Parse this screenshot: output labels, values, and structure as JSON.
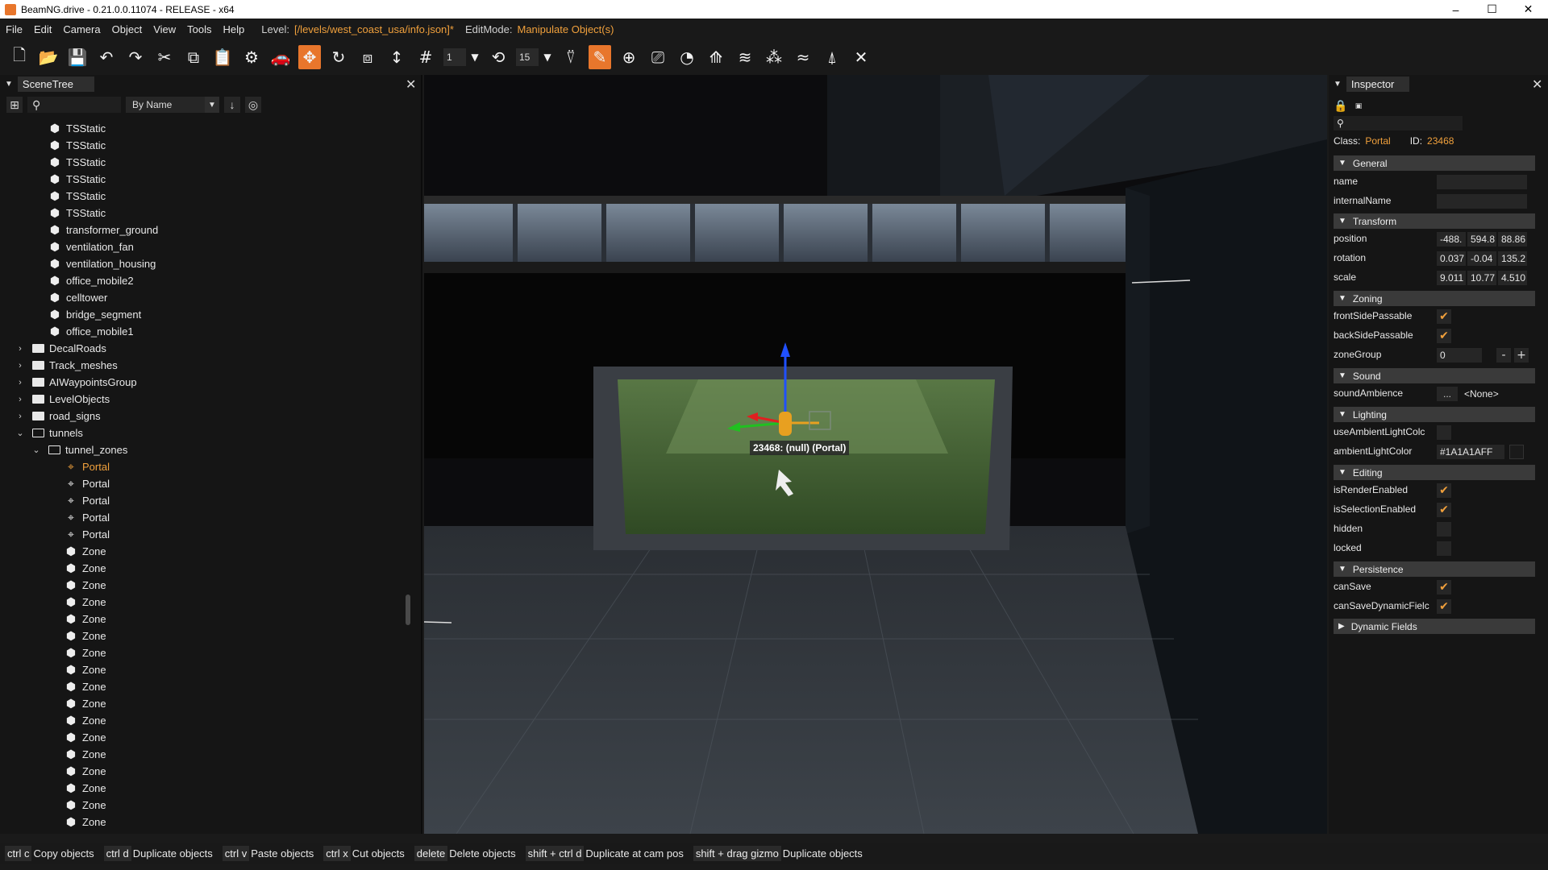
{
  "window": {
    "title": "BeamNG.drive - 0.21.0.0.11074 - RELEASE - x64",
    "minimize": "–",
    "maximize": "☐",
    "close": "✕"
  },
  "menu": {
    "items": [
      "File",
      "Edit",
      "Camera",
      "Object",
      "View",
      "Tools",
      "Help"
    ],
    "level_label": "Level:",
    "level_value": "[/levels/west_coast_usa/info.json]*",
    "editmode_label": "EditMode:",
    "editmode_value": "Manipulate Object(s)"
  },
  "toolbar": {
    "grid_value": "1",
    "rotate_snap_value": "15"
  },
  "scenetree": {
    "title": "SceneTree",
    "sort_option": "By Name",
    "items": [
      {
        "label": "TSStatic",
        "icon": "cube-icon",
        "depth": 2
      },
      {
        "label": "TSStatic",
        "icon": "cube-icon",
        "depth": 2
      },
      {
        "label": "TSStatic",
        "icon": "cube-icon",
        "depth": 2
      },
      {
        "label": "TSStatic",
        "icon": "cube-icon",
        "depth": 2
      },
      {
        "label": "TSStatic",
        "icon": "cube-icon",
        "depth": 2
      },
      {
        "label": "TSStatic",
        "icon": "cube-icon",
        "depth": 2
      },
      {
        "label": "transformer_ground",
        "icon": "cube-icon",
        "depth": 2
      },
      {
        "label": "ventilation_fan",
        "icon": "cube-icon",
        "depth": 2
      },
      {
        "label": "ventilation_housing",
        "icon": "cube-icon",
        "depth": 2
      },
      {
        "label": "office_mobile2",
        "icon": "cube-icon",
        "depth": 2
      },
      {
        "label": "celltower",
        "icon": "cube-icon",
        "depth": 2
      },
      {
        "label": "bridge_segment",
        "icon": "cube-icon",
        "depth": 2
      },
      {
        "label": "office_mobile1",
        "icon": "cube-icon",
        "depth": 2
      },
      {
        "label": "DecalRoads",
        "icon": "folder-icon",
        "depth": 1,
        "arrow": "›"
      },
      {
        "label": "Track_meshes",
        "icon": "folder-icon",
        "depth": 1,
        "arrow": "›"
      },
      {
        "label": "AIWaypointsGroup",
        "icon": "folder-icon",
        "depth": 1,
        "arrow": "›"
      },
      {
        "label": "LevelObjects",
        "icon": "folder-icon",
        "depth": 1,
        "arrow": "›"
      },
      {
        "label": "road_signs",
        "icon": "folder-icon",
        "depth": 1,
        "arrow": "›"
      },
      {
        "label": "tunnels",
        "icon": "folder-open-icon",
        "depth": 1,
        "arrow": "⌄"
      },
      {
        "label": "tunnel_zones",
        "icon": "folder-open-icon",
        "depth": 2,
        "arrow": "⌄"
      },
      {
        "label": "Portal",
        "icon": "portal-icon",
        "depth": 3,
        "selected": true
      },
      {
        "label": "Portal",
        "icon": "portal-icon",
        "depth": 3
      },
      {
        "label": "Portal",
        "icon": "portal-icon",
        "depth": 3
      },
      {
        "label": "Portal",
        "icon": "portal-icon",
        "depth": 3
      },
      {
        "label": "Portal",
        "icon": "portal-icon",
        "depth": 3
      },
      {
        "label": "Zone",
        "icon": "zone-icon",
        "depth": 3
      },
      {
        "label": "Zone",
        "icon": "zone-icon",
        "depth": 3
      },
      {
        "label": "Zone",
        "icon": "zone-icon",
        "depth": 3
      },
      {
        "label": "Zone",
        "icon": "zone-icon",
        "depth": 3
      },
      {
        "label": "Zone",
        "icon": "zone-icon",
        "depth": 3
      },
      {
        "label": "Zone",
        "icon": "zone-icon",
        "depth": 3
      },
      {
        "label": "Zone",
        "icon": "zone-icon",
        "depth": 3
      },
      {
        "label": "Zone",
        "icon": "zone-icon",
        "depth": 3
      },
      {
        "label": "Zone",
        "icon": "zone-icon",
        "depth": 3
      },
      {
        "label": "Zone",
        "icon": "zone-icon",
        "depth": 3
      },
      {
        "label": "Zone",
        "icon": "zone-icon",
        "depth": 3
      },
      {
        "label": "Zone",
        "icon": "zone-icon",
        "depth": 3
      },
      {
        "label": "Zone",
        "icon": "zone-icon",
        "depth": 3
      },
      {
        "label": "Zone",
        "icon": "zone-icon",
        "depth": 3
      },
      {
        "label": "Zone",
        "icon": "zone-icon",
        "depth": 3
      },
      {
        "label": "Zone",
        "icon": "zone-icon",
        "depth": 3
      },
      {
        "label": "Zone",
        "icon": "zone-icon",
        "depth": 3
      }
    ]
  },
  "viewport": {
    "selection_label": "23468: (null) (Portal)"
  },
  "inspector": {
    "title": "Inspector",
    "class_label": "Class:",
    "class_value": "Portal",
    "id_label": "ID:",
    "id_value": "23468",
    "sections": {
      "general": "General",
      "transform": "Transform",
      "zoning": "Zoning",
      "sound": "Sound",
      "lighting": "Lighting",
      "editing": "Editing",
      "persistence": "Persistence",
      "dynamic": "Dynamic Fields"
    },
    "fields": {
      "name": "name",
      "internalName": "internalName",
      "position": "position",
      "position_values": [
        "-488.",
        "594.8",
        "88.86"
      ],
      "rotation": "rotation",
      "rotation_values": [
        "0.037",
        "-0.04",
        "135.2"
      ],
      "scale": "scale",
      "scale_values": [
        "9.011",
        "10.77",
        "4.510"
      ],
      "frontSidePassable": "frontSidePassable",
      "backSidePassable": "backSidePassable",
      "zoneGroup": "zoneGroup",
      "zoneGroup_value": "0",
      "zoneGroup_minus": "-",
      "zoneGroup_plus": "+",
      "soundAmbience": "soundAmbience",
      "soundAmbience_btn": "...",
      "soundAmbience_value": "<None>",
      "useAmbientLightColor": "useAmbientLightColc",
      "ambientLightColor": "ambientLightColor",
      "ambientLightColor_value": "#1A1A1AFF",
      "isRenderEnabled": "isRenderEnabled",
      "isSelectionEnabled": "isSelectionEnabled",
      "hidden": "hidden",
      "locked": "locked",
      "canSave": "canSave",
      "canSaveDynamicFields": "canSaveDynamicFielc"
    }
  },
  "statusbar": {
    "hotkeys": [
      {
        "key": "ctrl c",
        "desc": "Copy objects"
      },
      {
        "key": "ctrl d",
        "desc": "Duplicate objects"
      },
      {
        "key": "ctrl v",
        "desc": "Paste objects"
      },
      {
        "key": "ctrl x",
        "desc": "Cut objects"
      },
      {
        "key": "delete",
        "desc": "Delete objects"
      },
      {
        "key": "shift + ctrl d",
        "desc": "Duplicate at cam pos"
      },
      {
        "key": "shift + drag gizmo",
        "desc": "Duplicate objects"
      }
    ]
  },
  "colors": {
    "accent": "#e8762c",
    "highlight_text": "#f0a03c",
    "panel_bg": "#151515",
    "section_bg": "#3a3a3a"
  }
}
